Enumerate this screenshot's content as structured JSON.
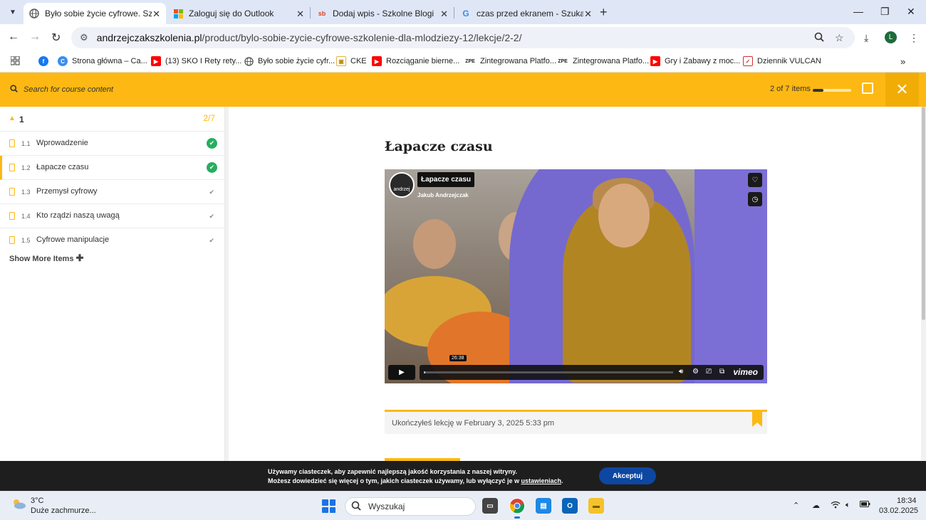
{
  "browser": {
    "tabs": [
      {
        "title": "Było sobie życie cyfrowe. Szkole",
        "favicon": "globe-icon",
        "active": true
      },
      {
        "title": "Zaloguj się do Outlook",
        "favicon": "microsoft-icon",
        "active": false
      },
      {
        "title": "Dodaj wpis - Szkolne Blogi",
        "favicon": "sb-icon",
        "favicon_text": "sb",
        "active": false
      },
      {
        "title": "czas przed ekranem - Szukaj w",
        "favicon": "google-icon",
        "favicon_text": "G",
        "active": false
      }
    ],
    "url_host": "andrzejczakszkolenia.pl",
    "url_path": "/product/bylo-sobie-zycie-cyfrowe-szkolenie-dla-mlodziezy-12/lekcje/2-2/",
    "profile_initial": "L",
    "bookmarks": [
      {
        "label": "Strona główna – Ca...",
        "icon": "chrome-icon"
      },
      {
        "label": "(13) SKO I Rety rety...",
        "icon": "youtube-icon"
      },
      {
        "label": "Było sobie życie cyfr...",
        "icon": "globe-icon"
      },
      {
        "label": "CKE",
        "icon": "cke-icon"
      },
      {
        "label": "Rozciąganie bierne...",
        "icon": "youtube-icon"
      },
      {
        "label": "Zintegrowana Platfo...",
        "icon": "zpe-icon",
        "icon_text": "ZPE"
      },
      {
        "label": "Zintegrowana Platfo...",
        "icon": "zpe-icon",
        "icon_text": "ZPE"
      },
      {
        "label": "Gry i Zabawy z moc...",
        "icon": "youtube-icon"
      },
      {
        "label": "Dziennik VULCAN",
        "icon": "vulcan-icon"
      }
    ]
  },
  "course_bar": {
    "search_placeholder": "Search for course content",
    "progress_text": "2 of 7 items",
    "progress_fraction": 0.2857
  },
  "sidebar": {
    "section_number": "1",
    "section_count": "2/7",
    "lessons": [
      {
        "number": "1.1",
        "title": "Wprowadzenie",
        "completed": true
      },
      {
        "number": "1.2",
        "title": "Łapacze czasu",
        "completed": true,
        "current": true
      },
      {
        "number": "1.3",
        "title": "Przemysł cyfrowy",
        "completed": false
      },
      {
        "number": "1.4",
        "title": "Kto rządzi naszą uwagą",
        "completed": false
      },
      {
        "number": "1.5",
        "title": "Cyfrowe manipulacje",
        "completed": false
      }
    ],
    "show_more": "Show More Items"
  },
  "main": {
    "lesson_title": "Łapacze czasu",
    "video": {
      "title": "Łapacze czasu",
      "author": "Jakub Andrzejczak",
      "badge_text": "andrzej",
      "duration": "26:38",
      "provider": "vimeo"
    },
    "completed_notice": "Ukończyłeś lekcję w February 3, 2025 5:33 pm"
  },
  "cookie": {
    "line1": "Używamy ciasteczek, aby zapewnić najlepszą jakość korzystania z naszej witryny.",
    "line2_prefix": "Możesz dowiedzieć się więcej o tym, jakich ciasteczek używamy, lub wyłączyć je w ",
    "line2_link": "ustawieniach",
    "line2_suffix": ".",
    "accept_label": "Akceptuj"
  },
  "taskbar": {
    "weather_temp": "3°C",
    "weather_desc": "Duże zachmurze...",
    "search_placeholder": "Wyszukaj",
    "time": "18:34",
    "date": "03.02.2025"
  },
  "colors": {
    "accent": "#fdb813",
    "success": "#27ae60",
    "cookie_button": "#0d47a1"
  }
}
